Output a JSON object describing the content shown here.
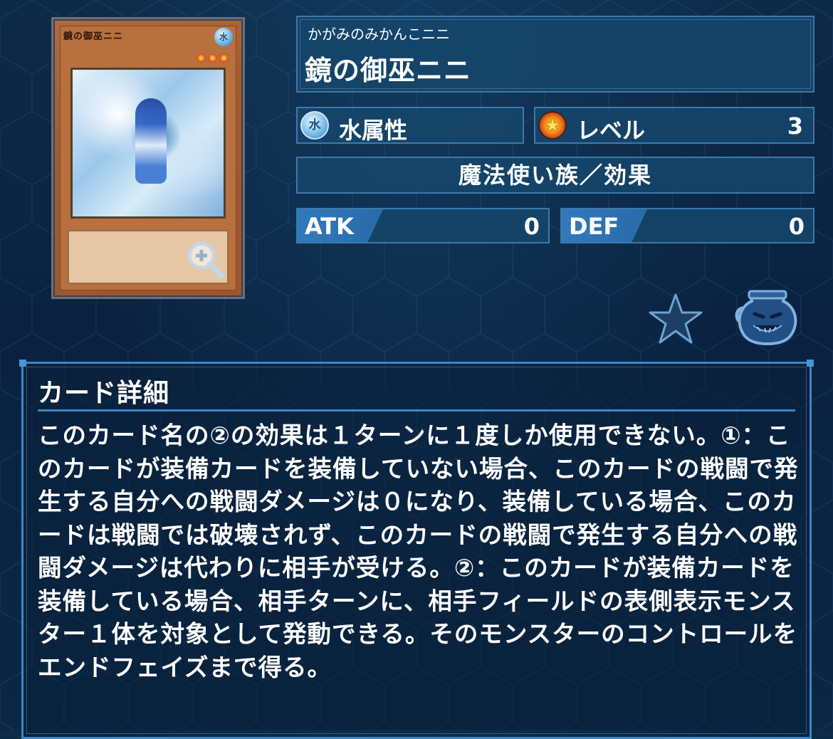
{
  "card": {
    "ruby": "かがみのみかんこニニ",
    "name": "鏡の御巫ニニ",
    "art_name": "鏡の御巫ニニ",
    "attribute": "水属性",
    "attribute_glyph": "水",
    "level_label": "レベル",
    "level": "3",
    "type_line": "魔法使い族／効果",
    "atk_label": "ATK",
    "atk": "0",
    "def_label": "DEF",
    "def": "0"
  },
  "details": {
    "title": "カード詳細",
    "text": "このカード名の②の効果は１ターンに１度しか使用できない。①：このカードが装備カードを装備していない場合、このカードの戦闘で発生する自分への戦闘ダメージは０になり、装備している場合、このカードは戦闘では破壊されず、このカードの戦闘で発生する自分への戦闘ダメージは代わりに相手が受ける。②：このカードが装備カードを装備している場合、相手ターンに、相手フィールドの表側表示モンスター１体を対象として発動できる。そのモンスターのコントロールをエンドフェイズまで得る。"
  },
  "icons": {
    "zoom": "zoom-in-icon",
    "favorite": "star-icon",
    "pot": "pot-of-greed-icon"
  },
  "colors": {
    "panel_bg": "#16466c",
    "panel_border": "#3e79a8",
    "accent": "#3d86c8",
    "card_frame": "#b26a3c"
  }
}
